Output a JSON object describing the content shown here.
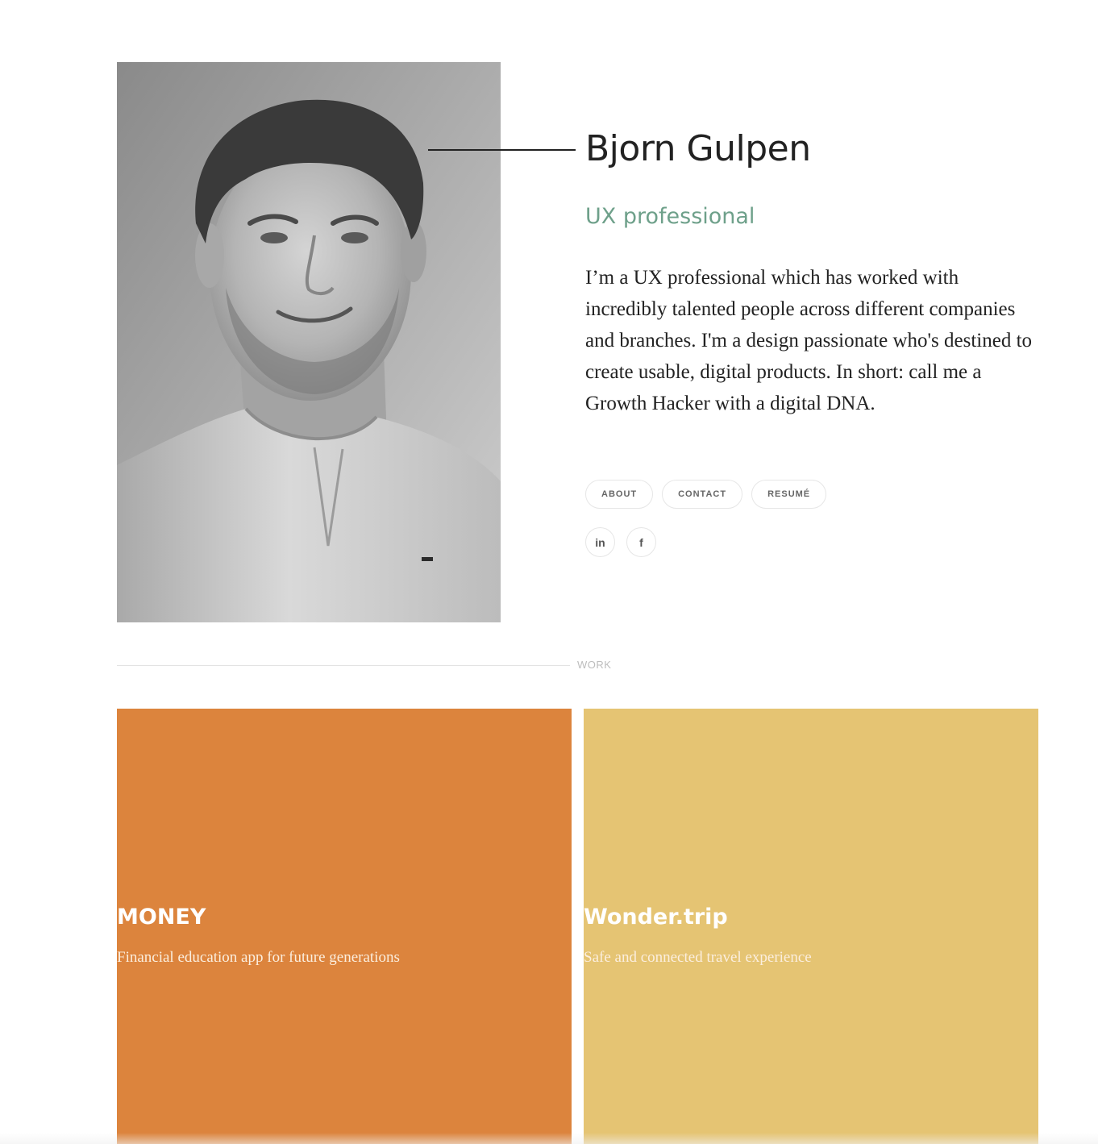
{
  "profile": {
    "name": "Bjorn Gulpen",
    "role": "UX professional",
    "bio": "I’m a UX professional which has worked with incredibly talented people across different companies and branches. I'm a design passionate who's destined to create usable, digital products. In short: call me a Growth Hacker with a digital DNA."
  },
  "nav": {
    "about": "ABOUT",
    "contact": "CONTACT",
    "resume": "RESUMÉ"
  },
  "social": {
    "linkedin": "in",
    "facebook": "f"
  },
  "section": {
    "work_label": "WORK"
  },
  "projects": [
    {
      "title": "MONEY",
      "subtitle": "Financial education app for future generations",
      "color": "#dc843d"
    },
    {
      "title": "Wonder.trip",
      "subtitle": "Safe and connected travel experience",
      "color": "#e5c473"
    }
  ],
  "colors": {
    "accent": "#6ea08a",
    "text": "#222222"
  },
  "icons": [
    "linkedin-icon",
    "facebook-icon"
  ]
}
